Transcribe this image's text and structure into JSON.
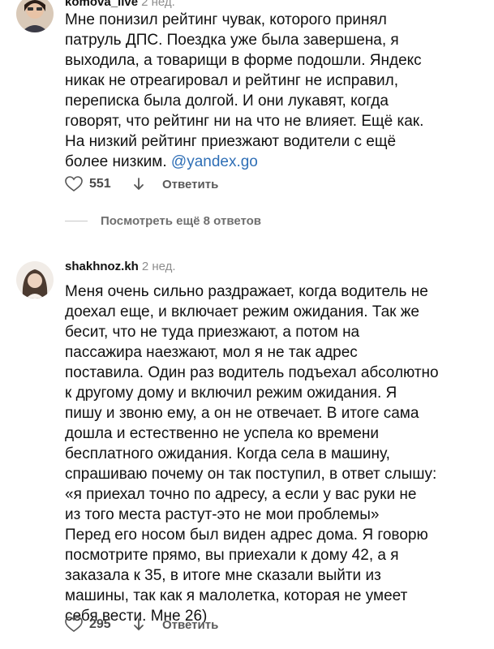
{
  "comments": [
    {
      "username": "komova_live",
      "time": "2 нед.",
      "lines": [
        "Мне понизил рейтинг чувак, которого принял",
        "патруль ДПС. Поездка уже была завершена, я",
        "выходила, а товарищи в форме подошли. Яндекс",
        "никак не отреагировал и рейтинг не исправил,",
        "переписка была долгой. И они лукавят, когда",
        "говорят, что рейтинг ни на что не влияет. Ещё как.",
        "На низкий рейтинг приезжают водители с ещё",
        "более низким."
      ],
      "mention": "@yandex.go",
      "likes": "551",
      "reply_label": "Ответить"
    },
    {
      "username": "shakhnoz.kh",
      "time": "2 нед.",
      "lines": [
        "Меня очень сильно раздражает, когда водитель не",
        "доехал еще, и включает режим ожидания. Так же",
        "бесит, что не туда приезжают, а потом на",
        "пассажира наезжают, мол я не так адрес",
        "поставила. Один раз водитель подъехал абсолютно",
        "к другому дому и включил режим ожидания. Я",
        "пишу и звоню ему, а он не отвечает. В итоге сама",
        "дошла и естественно не успела ко времени",
        "бесплатного ожидания. Когда села в машину,",
        "спрашиваю почему он так поступил, в ответ слышу:",
        "«я приехал точно по адресу, а если у вас руки не",
        "из того места растут-это не мои проблемы»",
        "Перед его носом был виден адрес дома. Я говорю",
        "посмотрите прямо, вы приехали к дому 42, а я",
        "заказала к 35, в итоге мне сказали выйти из",
        "машины, так как я малолетка, которая не умеет",
        "себя вести. Мне 26)"
      ],
      "likes": "295",
      "reply_label": "Ответить"
    }
  ],
  "more_replies_label": "Посмотреть ещё 8 ответов",
  "colors": {
    "mention": "#2f6fb6",
    "muted": "#8e8e8e"
  },
  "icons": [
    "heart-icon",
    "arrow-down-icon"
  ]
}
